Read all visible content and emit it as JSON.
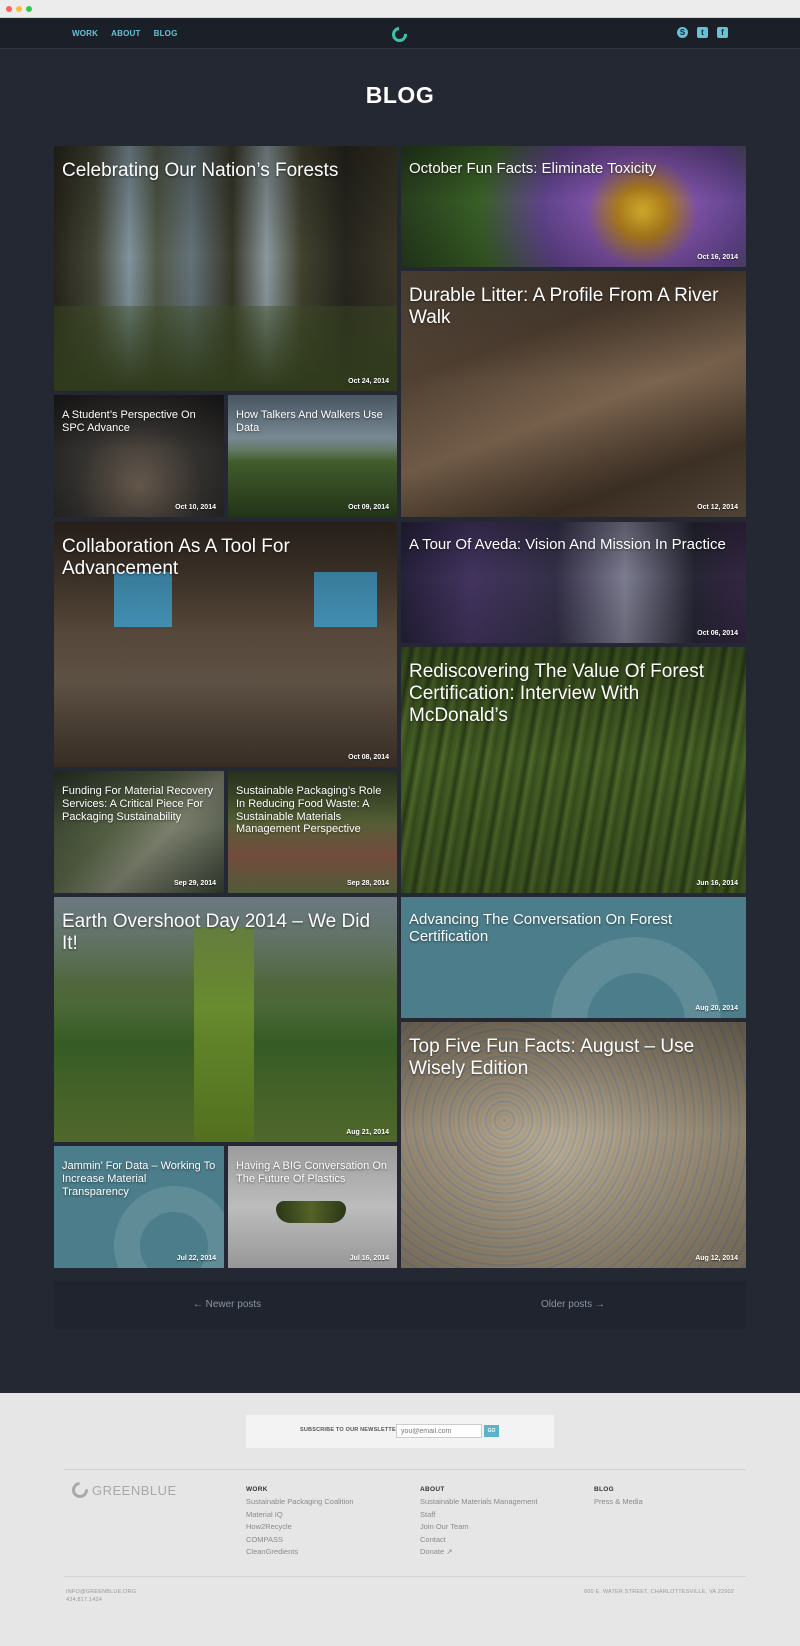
{
  "nav": {
    "links": [
      "WORK",
      "ABOUT",
      "BLOG"
    ],
    "social": [
      "S",
      "t",
      "f"
    ]
  },
  "page_title": "BLOG",
  "posts": [
    {
      "title": "Celebrating Our Nation’s Forests",
      "date": "Oct 24, 2014"
    },
    {
      "title": "October Fun Facts: Eliminate Toxicity",
      "date": "Oct 16, 2014"
    },
    {
      "title": "Durable Litter: A Profile From A River Walk",
      "date": "Oct 12, 2014"
    },
    {
      "title": "A Student’s Perspective On SPC Advance",
      "date": "Oct 10, 2014"
    },
    {
      "title": "How Talkers And Walkers Use Data",
      "date": "Oct 09, 2014"
    },
    {
      "title": "Collaboration As A Tool For Advancement",
      "date": "Oct 08, 2014"
    },
    {
      "title": "A Tour Of Aveda: Vision And Mission In Practice",
      "date": "Oct 06, 2014"
    },
    {
      "title": "Rediscovering The Value Of Forest Certification: Interview With McDonald’s",
      "date": "Jun 16, 2014"
    },
    {
      "title": "Funding For Material Recovery Services: A Critical Piece For Packaging Sustainability",
      "date": "Sep 29, 2014"
    },
    {
      "title": "Sustainable Packaging’s Role In Reducing Food Waste: A Sustainable Materials Management Perspective",
      "date": "Sep 28, 2014"
    },
    {
      "title": "Earth Overshoot Day 2014 – We Did It!",
      "date": "Aug 21, 2014"
    },
    {
      "title": "Advancing The Conversation On Forest Certification",
      "date": "Aug 20, 2014"
    },
    {
      "title": "Top Five Fun Facts: August – Use Wisely Edition",
      "date": "Aug 12, 2014"
    },
    {
      "title": "Jammin’ For Data – Working To Increase Material Transparency",
      "date": "Jul 22, 2014"
    },
    {
      "title": "Having A BIG Conversation On The Future Of Plastics",
      "date": "Jul 16, 2014"
    }
  ],
  "pager": {
    "newer": "← Newer posts",
    "older": "Older posts →"
  },
  "footer": {
    "newsletter_label": "SUBSCRIBE TO OUR NEWSLETTER",
    "newsletter_placeholder": "you@email.com",
    "newsletter_button": "GO",
    "brand": "GREENBLUE",
    "work_heading": "WORK",
    "work_links": [
      "Sustainable Packaging Coalition",
      "Material IQ",
      "How2Recycle",
      "COMPASS",
      "CleanGredients"
    ],
    "about_heading": "ABOUT",
    "about_links": [
      "Sustainable Materials Management",
      "Staff",
      "Join Our Team",
      "Contact",
      "Donate ↗"
    ],
    "blog_heading": "BLOG",
    "blog_links": [
      "Press & Media"
    ],
    "email": "INFO@GREENBLUE.ORG",
    "phone": "434.817.1424",
    "address": "600 E. WATER STREET, CHARLOTTESVILLE, VA 22902"
  }
}
